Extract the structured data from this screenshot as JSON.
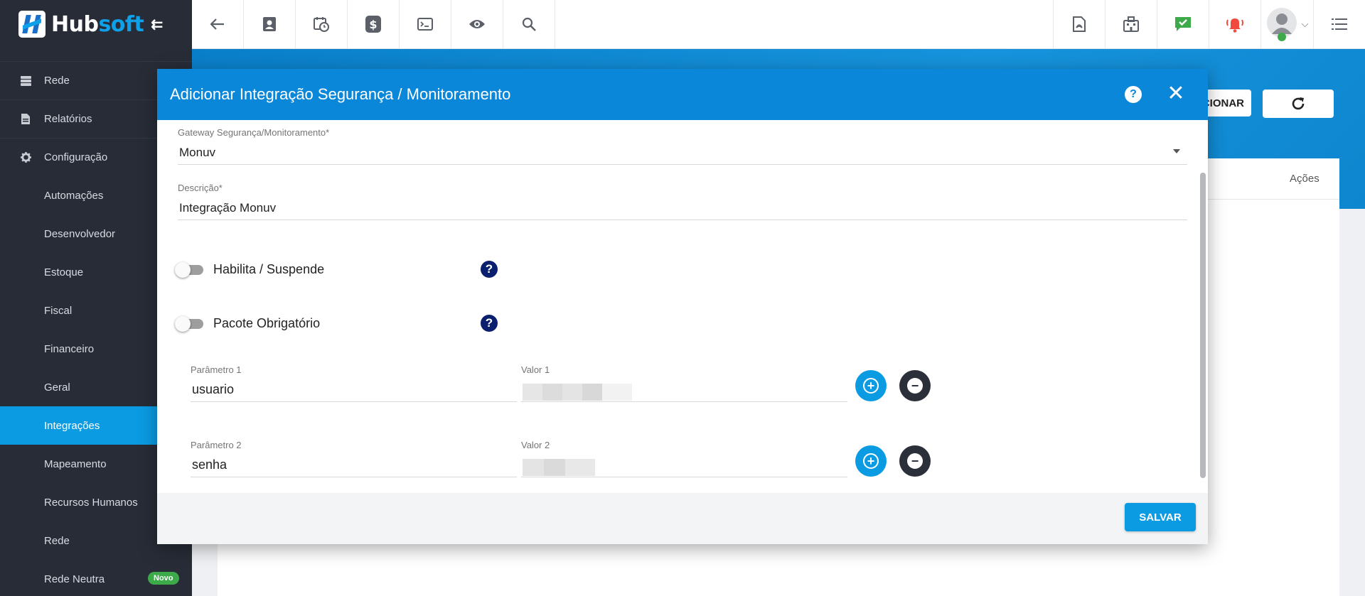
{
  "logo": {
    "part1": "Hub",
    "part2": "soft"
  },
  "sidebar": {
    "items": [
      {
        "label": "Rede"
      },
      {
        "label": "Relatórios"
      },
      {
        "label": "Configuração"
      },
      {
        "label": "Automações"
      },
      {
        "label": "Desenvolvedor"
      },
      {
        "label": "Estoque"
      },
      {
        "label": "Fiscal"
      },
      {
        "label": "Financeiro"
      },
      {
        "label": "Geral"
      },
      {
        "label": "Integrações"
      },
      {
        "label": "Mapeamento"
      },
      {
        "label": "Recursos Humanos"
      },
      {
        "label": "Rede"
      },
      {
        "label": "Rede Neutra",
        "badge": "Novo"
      }
    ]
  },
  "page": {
    "add_button_label": "ADICIONAR",
    "visible_add_fragment": "CIONAR",
    "table_header_actions": "Ações"
  },
  "modal": {
    "title": "Adicionar Integração Segurança / Monitoramento",
    "help_glyph": "?",
    "close_glyph": "✕",
    "gateway": {
      "label": "Gateway Segurança/Monitoramento",
      "required": "*",
      "value": "Monuv"
    },
    "descricao": {
      "label": "Descrição",
      "required": "*",
      "value": "Integração Monuv"
    },
    "toggles": [
      {
        "label": "Habilita / Suspende"
      },
      {
        "label": "Pacote Obrigatório"
      }
    ],
    "params": [
      {
        "param_label": "Parâmetro 1",
        "param_value": "usuario",
        "value_label": "Valor 1"
      },
      {
        "param_label": "Parâmetro 2",
        "param_value": "senha",
        "value_label": "Valor 2"
      }
    ],
    "save_label": "SALVAR"
  },
  "colors": {
    "primary": "#0b87d9",
    "accent": "#0b9be3",
    "sidebar_bg": "#272c37",
    "badge_green": "#3daa4a",
    "help_navy": "#0a1f6e",
    "check_green": "#3daa4a",
    "bell_red": "#f04a3e"
  }
}
